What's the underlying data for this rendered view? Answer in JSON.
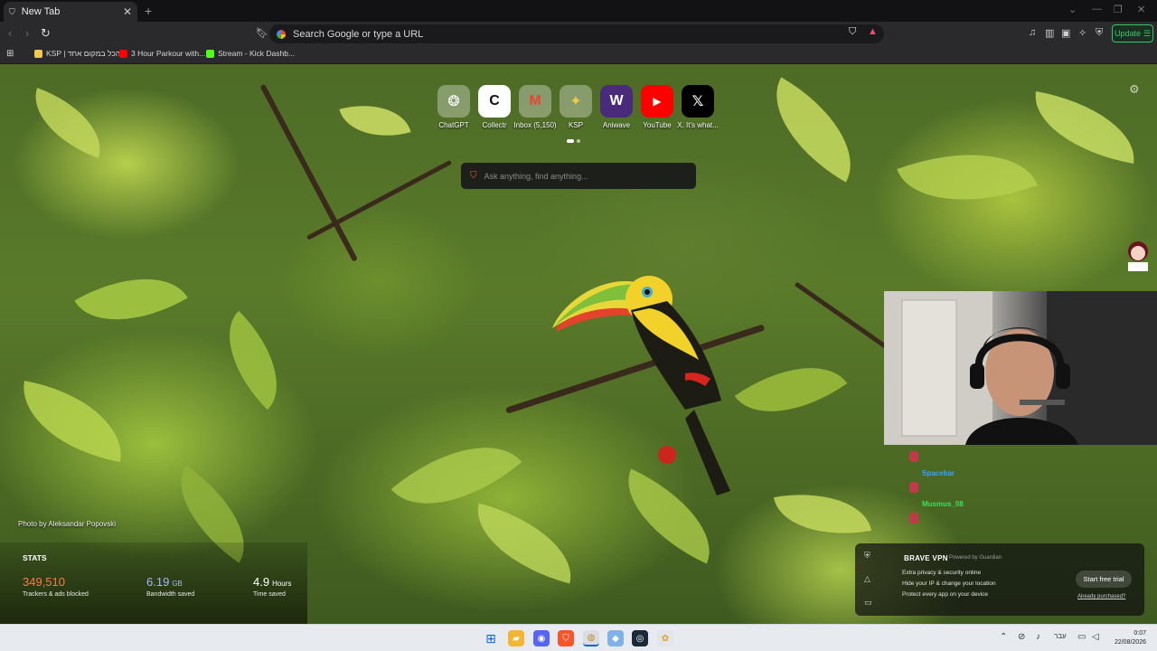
{
  "browser": {
    "tab": {
      "title": "New Tab",
      "close": "✕"
    },
    "new_tab_glyph": "+",
    "window_controls": [
      "⌄",
      "—",
      "❐",
      "✕"
    ],
    "nav": {
      "back": "‹",
      "forward": "›",
      "reload": "↻"
    },
    "omnibox": {
      "placeholder": "Search Google or type a URL"
    },
    "update_label": "Update",
    "accent_color": "#3ec46d",
    "bookmarks": [
      {
        "label": "KSP | הכל במקום אחד",
        "color": "#f2c84b"
      },
      {
        "label": "3 Hour Parkour with...",
        "color": "#ff0000"
      },
      {
        "label": "Stream - Kick Dashb...",
        "color": "#53fc18"
      }
    ]
  },
  "ntp": {
    "top_sites": [
      {
        "label": "ChatGPT",
        "glyph": "❂",
        "icon": "chatgpt-icon",
        "bg": "rgba(255,255,255,.32)",
        "fg": "#ffffff"
      },
      {
        "label": "Collectr",
        "glyph": "C",
        "icon": "collectr-icon",
        "bg": "#ffffff",
        "fg": "#111111"
      },
      {
        "label": "Inbox (5,150)",
        "glyph": "M",
        "icon": "gmail-icon",
        "bg": "rgba(255,255,255,.32)",
        "fg": "#ea4335"
      },
      {
        "label": "KSP",
        "glyph": "✦",
        "icon": "ksp-icon",
        "bg": "rgba(255,255,255,.32)",
        "fg": "#f2c84b"
      },
      {
        "label": "Aniwave",
        "glyph": "W",
        "icon": "aniwave-icon",
        "bg": "#4a2a7a",
        "fg": "#ffffff"
      },
      {
        "label": "YouTube",
        "glyph": "▶",
        "icon": "youtube-icon",
        "bg": "#ff0000",
        "fg": "#ffffff"
      },
      {
        "label": "X. It's what...",
        "glyph": "𝕏",
        "icon": "x-icon",
        "bg": "#000000",
        "fg": "#ffffff"
      }
    ],
    "search_placeholder": "Ask anything, find anything...",
    "photo_credit": "Photo by Aleksandar Popovski",
    "stats": {
      "title": "STATS",
      "trackers": {
        "value": "349,510",
        "caption": "Trackers & ads blocked",
        "color": "#ff7a45"
      },
      "bandwidth": {
        "value": "6.19",
        "unit": "GB",
        "caption": "Bandwidth saved",
        "color": "#a7b8ff"
      },
      "time": {
        "value": "4.9",
        "unit": "Hours",
        "caption": "Time saved",
        "color": "#ffffff"
      }
    },
    "vpn": {
      "title": "BRAVE VPN",
      "powered": "Powered by Guardian",
      "features": [
        "Extra privacy & security online",
        "Hide your IP & change your location",
        "Protect every app on your device"
      ],
      "cta": "Start free trial",
      "link": "Already purchased?"
    }
  },
  "overlay": {
    "chat": [
      {
        "name": "Spacebar",
        "color": "#3aa0ff"
      },
      {
        "name": "Musmus_08",
        "color": "#3be05a"
      }
    ]
  },
  "taskbar": {
    "lang": "עבר",
    "time": "0:07",
    "date": "22/08/2026"
  }
}
